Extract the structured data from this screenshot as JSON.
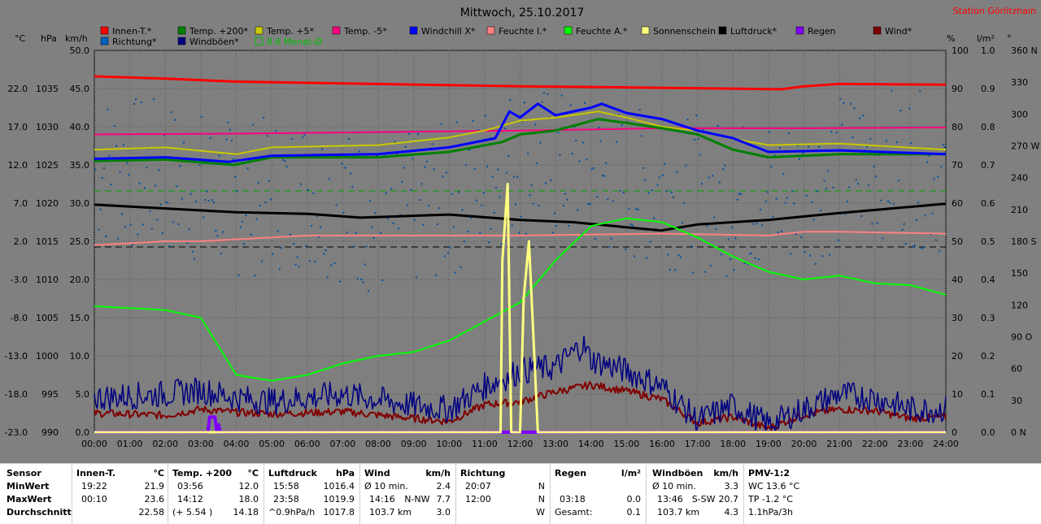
{
  "title": "Mittwoch, 25.10.2017",
  "station": "Station Görlitzhain",
  "left_units": [
    "°C",
    "hPa",
    "km/h"
  ],
  "right_units": [
    "%",
    "l/m²",
    "°"
  ],
  "legend": [
    {
      "label": "Innen-T.*",
      "color": "#ff0000"
    },
    {
      "label": "Temp. +200*",
      "color": "#008000"
    },
    {
      "label": "Temp. +5*",
      "color": "#c8c800"
    },
    {
      "label": "Temp. -5*",
      "color": "#ff0080"
    },
    {
      "label": "Windchill X*",
      "color": "#0000ff"
    },
    {
      "label": "Feuchte I.*",
      "color": "#ff8080"
    },
    {
      "label": "Feuchte A.*",
      "color": "#00ff00"
    },
    {
      "label": "Sonnenschein",
      "color": "#ffff80"
    },
    {
      "label": "Luftdruck*",
      "color": "#000000"
    },
    {
      "label": "Regen",
      "color": "#8000ff"
    },
    {
      "label": "Wind*",
      "color": "#800000"
    },
    {
      "label": "Richtung*",
      "color": "#0060c0"
    },
    {
      "label": "Windböen*",
      "color": "#000080"
    },
    {
      "label": "8.6 Monat-Ø",
      "color": "#00c000"
    }
  ],
  "axes": {
    "temp": [
      "22.0",
      "17.0",
      "12.0",
      "7.0",
      "2.0",
      "-3.0",
      "-8.0",
      "-13.0",
      "-18.0",
      "-23.0"
    ],
    "hpa": [
      "1035",
      "1030",
      "1025",
      "1020",
      "1015",
      "1010",
      "1005",
      "1000",
      "995",
      "990"
    ],
    "kmh": [
      "50.0",
      "45.0",
      "40.0",
      "35.0",
      "30.0",
      "25.0",
      "20.0",
      "15.0",
      "10.0",
      "5.0",
      "0.0"
    ],
    "pct": [
      "100",
      "90",
      "80",
      "70",
      "60",
      "50",
      "40",
      "30",
      "20",
      "10",
      "0"
    ],
    "rain": [
      "1.0",
      "0.9",
      "0.8",
      "0.7",
      "0.6",
      "0.5",
      "0.4",
      "0.3",
      "0.2",
      "0.1",
      "0.0"
    ],
    "deg": [
      "360 N",
      "330",
      "300",
      "270 W",
      "240",
      "210",
      "180 S",
      "150",
      "120",
      "90 O",
      "60",
      "30",
      "0 N"
    ],
    "hours": [
      "00:00",
      "01:00",
      "02:00",
      "03:00",
      "04:00",
      "05:00",
      "06:00",
      "07:00",
      "08:00",
      "09:00",
      "10:00",
      "11:00",
      "12:00",
      "13:00",
      "14:00",
      "15:00",
      "16:00",
      "17:00",
      "18:00",
      "19:00",
      "20:00",
      "21:00",
      "22:00",
      "23:00",
      "24:00"
    ]
  },
  "chart_data": {
    "type": "line",
    "title": "Mittwoch, 25.10.2017",
    "x_unit": "h",
    "xlim": [
      0,
      24
    ],
    "series": [
      {
        "name": "Innen-T.*",
        "unit": "°C",
        "points": [
          [
            0,
            23.6
          ],
          [
            2,
            23.3
          ],
          [
            4,
            22.9
          ],
          [
            8,
            22.6
          ],
          [
            12,
            22.3
          ],
          [
            16,
            22.1
          ],
          [
            19.37,
            21.9
          ],
          [
            20,
            22.3
          ],
          [
            21,
            22.6
          ],
          [
            24,
            22.5
          ]
        ]
      },
      {
        "name": "Temp. +200*",
        "unit": "°C",
        "points": [
          [
            0,
            12.5
          ],
          [
            2,
            12.7
          ],
          [
            3.94,
            12.0
          ],
          [
            5,
            13.0
          ],
          [
            8,
            13.0
          ],
          [
            10,
            13.7
          ],
          [
            11.5,
            15.0
          ],
          [
            12,
            16.0
          ],
          [
            13,
            16.5
          ],
          [
            14.2,
            18.0
          ],
          [
            15,
            17.5
          ],
          [
            16,
            16.8
          ],
          [
            17,
            16.0
          ],
          [
            18,
            14.0
          ],
          [
            19,
            13.0
          ],
          [
            21,
            13.4
          ],
          [
            24,
            13.4
          ]
        ]
      },
      {
        "name": "Temp. +5*",
        "unit": "°C",
        "points": [
          [
            0,
            14.0
          ],
          [
            2,
            14.3
          ],
          [
            4,
            13.4
          ],
          [
            5,
            14.3
          ],
          [
            8,
            14.6
          ],
          [
            10,
            15.6
          ],
          [
            11,
            16.5
          ],
          [
            12,
            17.8
          ],
          [
            13,
            18.2
          ],
          [
            14.2,
            19.0
          ],
          [
            15,
            18.2
          ],
          [
            16,
            17.0
          ],
          [
            17,
            16.5
          ],
          [
            18,
            15.4
          ],
          [
            19,
            14.6
          ],
          [
            21,
            14.8
          ],
          [
            24,
            14.0
          ]
        ]
      },
      {
        "name": "Temp. -5*",
        "unit": "°C",
        "points": [
          [
            0,
            16.0
          ],
          [
            4,
            16.1
          ],
          [
            8,
            16.3
          ],
          [
            12,
            16.5
          ],
          [
            16,
            16.8
          ],
          [
            20,
            16.8
          ],
          [
            24,
            16.9
          ]
        ]
      },
      {
        "name": "Windchill X*",
        "unit": "°C",
        "points": [
          [
            0,
            12.8
          ],
          [
            2,
            13.0
          ],
          [
            3.8,
            12.4
          ],
          [
            5,
            13.2
          ],
          [
            8,
            13.4
          ],
          [
            10,
            14.3
          ],
          [
            11.3,
            15.5
          ],
          [
            11.7,
            19.0
          ],
          [
            12,
            18.2
          ],
          [
            12.5,
            20.0
          ],
          [
            13,
            18.5
          ],
          [
            14,
            19.5
          ],
          [
            14.3,
            20.0
          ],
          [
            15,
            18.8
          ],
          [
            16,
            18.0
          ],
          [
            17,
            16.5
          ],
          [
            18,
            15.5
          ],
          [
            19,
            13.7
          ],
          [
            21,
            13.9
          ],
          [
            24,
            13.4
          ]
        ]
      },
      {
        "name": "Feuchte I.*",
        "unit": "%",
        "points": [
          [
            0,
            49
          ],
          [
            2,
            50
          ],
          [
            3,
            50
          ],
          [
            5,
            51
          ],
          [
            6,
            51.5
          ],
          [
            10,
            51.5
          ],
          [
            12,
            51.5
          ],
          [
            16,
            52
          ],
          [
            19,
            51.5
          ],
          [
            20,
            52.5
          ],
          [
            21,
            52.5
          ],
          [
            24,
            52
          ]
        ]
      },
      {
        "name": "Feuchte A.*",
        "unit": "%",
        "points": [
          [
            0,
            33
          ],
          [
            2,
            32
          ],
          [
            3,
            30
          ],
          [
            4,
            15
          ],
          [
            5,
            13.5
          ],
          [
            6,
            15
          ],
          [
            7,
            18
          ],
          [
            8,
            20
          ],
          [
            9,
            21
          ],
          [
            10,
            24
          ],
          [
            11,
            29
          ],
          [
            12,
            34
          ],
          [
            13,
            45
          ],
          [
            14,
            54
          ],
          [
            15,
            56
          ],
          [
            16,
            55
          ],
          [
            17,
            51
          ],
          [
            18,
            46
          ],
          [
            19,
            42
          ],
          [
            20,
            40
          ],
          [
            21,
            41
          ],
          [
            22,
            39
          ],
          [
            23,
            38.5
          ],
          [
            24,
            36
          ]
        ]
      },
      {
        "name": "Luftdruck*",
        "unit": "hPa",
        "points": [
          [
            0,
            1019.8
          ],
          [
            2,
            1019.3
          ],
          [
            4,
            1018.8
          ],
          [
            6,
            1018.6
          ],
          [
            7.5,
            1018.1
          ],
          [
            10,
            1018.5
          ],
          [
            12,
            1017.8
          ],
          [
            13.5,
            1017.5
          ],
          [
            15.97,
            1016.4
          ],
          [
            17,
            1017.2
          ],
          [
            19,
            1017.8
          ],
          [
            21,
            1018.7
          ],
          [
            23.97,
            1019.9
          ],
          [
            24,
            1019.9
          ]
        ]
      },
      {
        "name": "Sonnenschein",
        "unit": "%",
        "points": [
          [
            0,
            0
          ],
          [
            11.45,
            0
          ],
          [
            11.5,
            45
          ],
          [
            11.65,
            65
          ],
          [
            11.75,
            0
          ],
          [
            12.0,
            0
          ],
          [
            12.1,
            35
          ],
          [
            12.25,
            50
          ],
          [
            12.4,
            20
          ],
          [
            12.5,
            0
          ],
          [
            24,
            0
          ]
        ]
      },
      {
        "name": "Regen",
        "unit": "l/m²",
        "points": [
          [
            0,
            0
          ],
          [
            3.2,
            0
          ],
          [
            3.25,
            0.04
          ],
          [
            3.4,
            0.04
          ],
          [
            3.45,
            0.0
          ],
          [
            3.5,
            0.02
          ],
          [
            3.55,
            0
          ],
          [
            24,
            0
          ]
        ]
      },
      {
        "name": "Wind*",
        "unit": "km/h",
        "points": [
          [
            0,
            2.5
          ],
          [
            2,
            2.2
          ],
          [
            3,
            3.0
          ],
          [
            4,
            2.6
          ],
          [
            5,
            2.4
          ],
          [
            7,
            2.7
          ],
          [
            9,
            1.8
          ],
          [
            10,
            1.4
          ],
          [
            11,
            3.6
          ],
          [
            12,
            4.0
          ],
          [
            13,
            5.3
          ],
          [
            14,
            6.2
          ],
          [
            15,
            5.4
          ],
          [
            16,
            4.3
          ],
          [
            17,
            1.2
          ],
          [
            18,
            2.0
          ],
          [
            19,
            0.5
          ],
          [
            20,
            2.3
          ],
          [
            21,
            3.0
          ],
          [
            22,
            2.8
          ],
          [
            23,
            1.8
          ],
          [
            24,
            2.0
          ]
        ]
      },
      {
        "name": "Windböen*",
        "unit": "km/h",
        "points": [
          [
            0,
            4.5
          ],
          [
            2,
            5.0
          ],
          [
            3,
            5.5
          ],
          [
            4,
            4.5
          ],
          [
            5,
            4.0
          ],
          [
            7,
            5.0
          ],
          [
            9,
            3.5
          ],
          [
            10,
            3.0
          ],
          [
            11,
            6.0
          ],
          [
            12,
            8.0
          ],
          [
            13,
            8.5
          ],
          [
            13.77,
            11.5
          ],
          [
            14,
            9.5
          ],
          [
            15,
            8.0
          ],
          [
            16,
            6.0
          ],
          [
            17,
            1.5
          ],
          [
            18,
            3.5
          ],
          [
            19,
            1.0
          ],
          [
            20,
            3.0
          ],
          [
            21,
            5.0
          ],
          [
            22,
            4.5
          ],
          [
            23,
            3.0
          ],
          [
            24,
            3.0
          ]
        ]
      },
      {
        "name": "Richtung*",
        "unit": "°",
        "points": [
          [
            0,
            250
          ],
          [
            2,
            240
          ],
          [
            4,
            220
          ],
          [
            6,
            230
          ],
          [
            8,
            200
          ],
          [
            10,
            220
          ],
          [
            12,
            260
          ],
          [
            14,
            240
          ],
          [
            16,
            230
          ],
          [
            18,
            220
          ],
          [
            20,
            230
          ],
          [
            22,
            260
          ],
          [
            24,
            240
          ]
        ]
      },
      {
        "name": "8.6 Monat-Ø",
        "unit": "°C",
        "points": [
          [
            0,
            8.6
          ],
          [
            24,
            8.6
          ]
        ]
      }
    ],
    "ylim_left_temp": [
      -23,
      27
    ],
    "ylim_pressure": [
      990,
      1040
    ],
    "ylim_kmh": [
      0,
      50
    ],
    "ylim_pct": [
      0,
      100
    ],
    "ylim_rain": [
      0,
      1.0
    ],
    "ylim_deg": [
      0,
      360
    ],
    "grid": true,
    "legend": "top"
  },
  "table": {
    "sensor": {
      "header": "Sensor",
      "rows": [
        "MinWert",
        "MaxWert",
        "Durchschnitt"
      ]
    },
    "innen": {
      "header": "Innen-T.",
      "unit": "°C",
      "rows": [
        [
          "19:22",
          "21.9"
        ],
        [
          "00:10",
          "23.6"
        ],
        [
          "",
          "22.58"
        ]
      ]
    },
    "temp200": {
      "header": "Temp. +200",
      "unit": "°C",
      "rows": [
        [
          "03:56",
          "12.0"
        ],
        [
          "14:12",
          "18.0"
        ],
        [
          "(+ 5.54 )",
          "14.18"
        ]
      ]
    },
    "luftdruck": {
      "header": "Luftdruck",
      "unit": "hPa",
      "rows": [
        [
          "15:58",
          "1016.4"
        ],
        [
          "23:58",
          "1019.9"
        ],
        [
          "^0.9hPa/h",
          "1017.8"
        ]
      ]
    },
    "wind": {
      "header": "Wind",
      "unit": "km/h",
      "rows": [
        [
          "Ø 10 min.",
          "",
          "2.4"
        ],
        [
          "14:16",
          "N-NW",
          "7.7"
        ],
        [
          "103.7 km",
          "",
          "3.0"
        ]
      ]
    },
    "richtung": {
      "header": "Richtung",
      "rows": [
        [
          "20:07",
          "N"
        ],
        [
          "12:00",
          "N"
        ],
        [
          "",
          "W"
        ]
      ]
    },
    "regen": {
      "header": "Regen",
      "unit": "l/m²",
      "rows": [
        [
          "",
          ""
        ],
        [
          "03:18",
          "0.0"
        ],
        [
          "Gesamt:",
          "0.1"
        ]
      ]
    },
    "boeen": {
      "header": "Windböen",
      "unit": "km/h",
      "rows": [
        [
          "Ø 10 min.",
          "",
          "3.3"
        ],
        [
          "13:46",
          "S-SW",
          "20.7"
        ],
        [
          "103.7 km",
          "",
          "4.3"
        ]
      ]
    },
    "pmv": {
      "header": "PMV-1:2",
      "rows": [
        "WC 13.6 °C",
        "TP -1.2 °C",
        "1.1hPa/3h"
      ]
    }
  }
}
